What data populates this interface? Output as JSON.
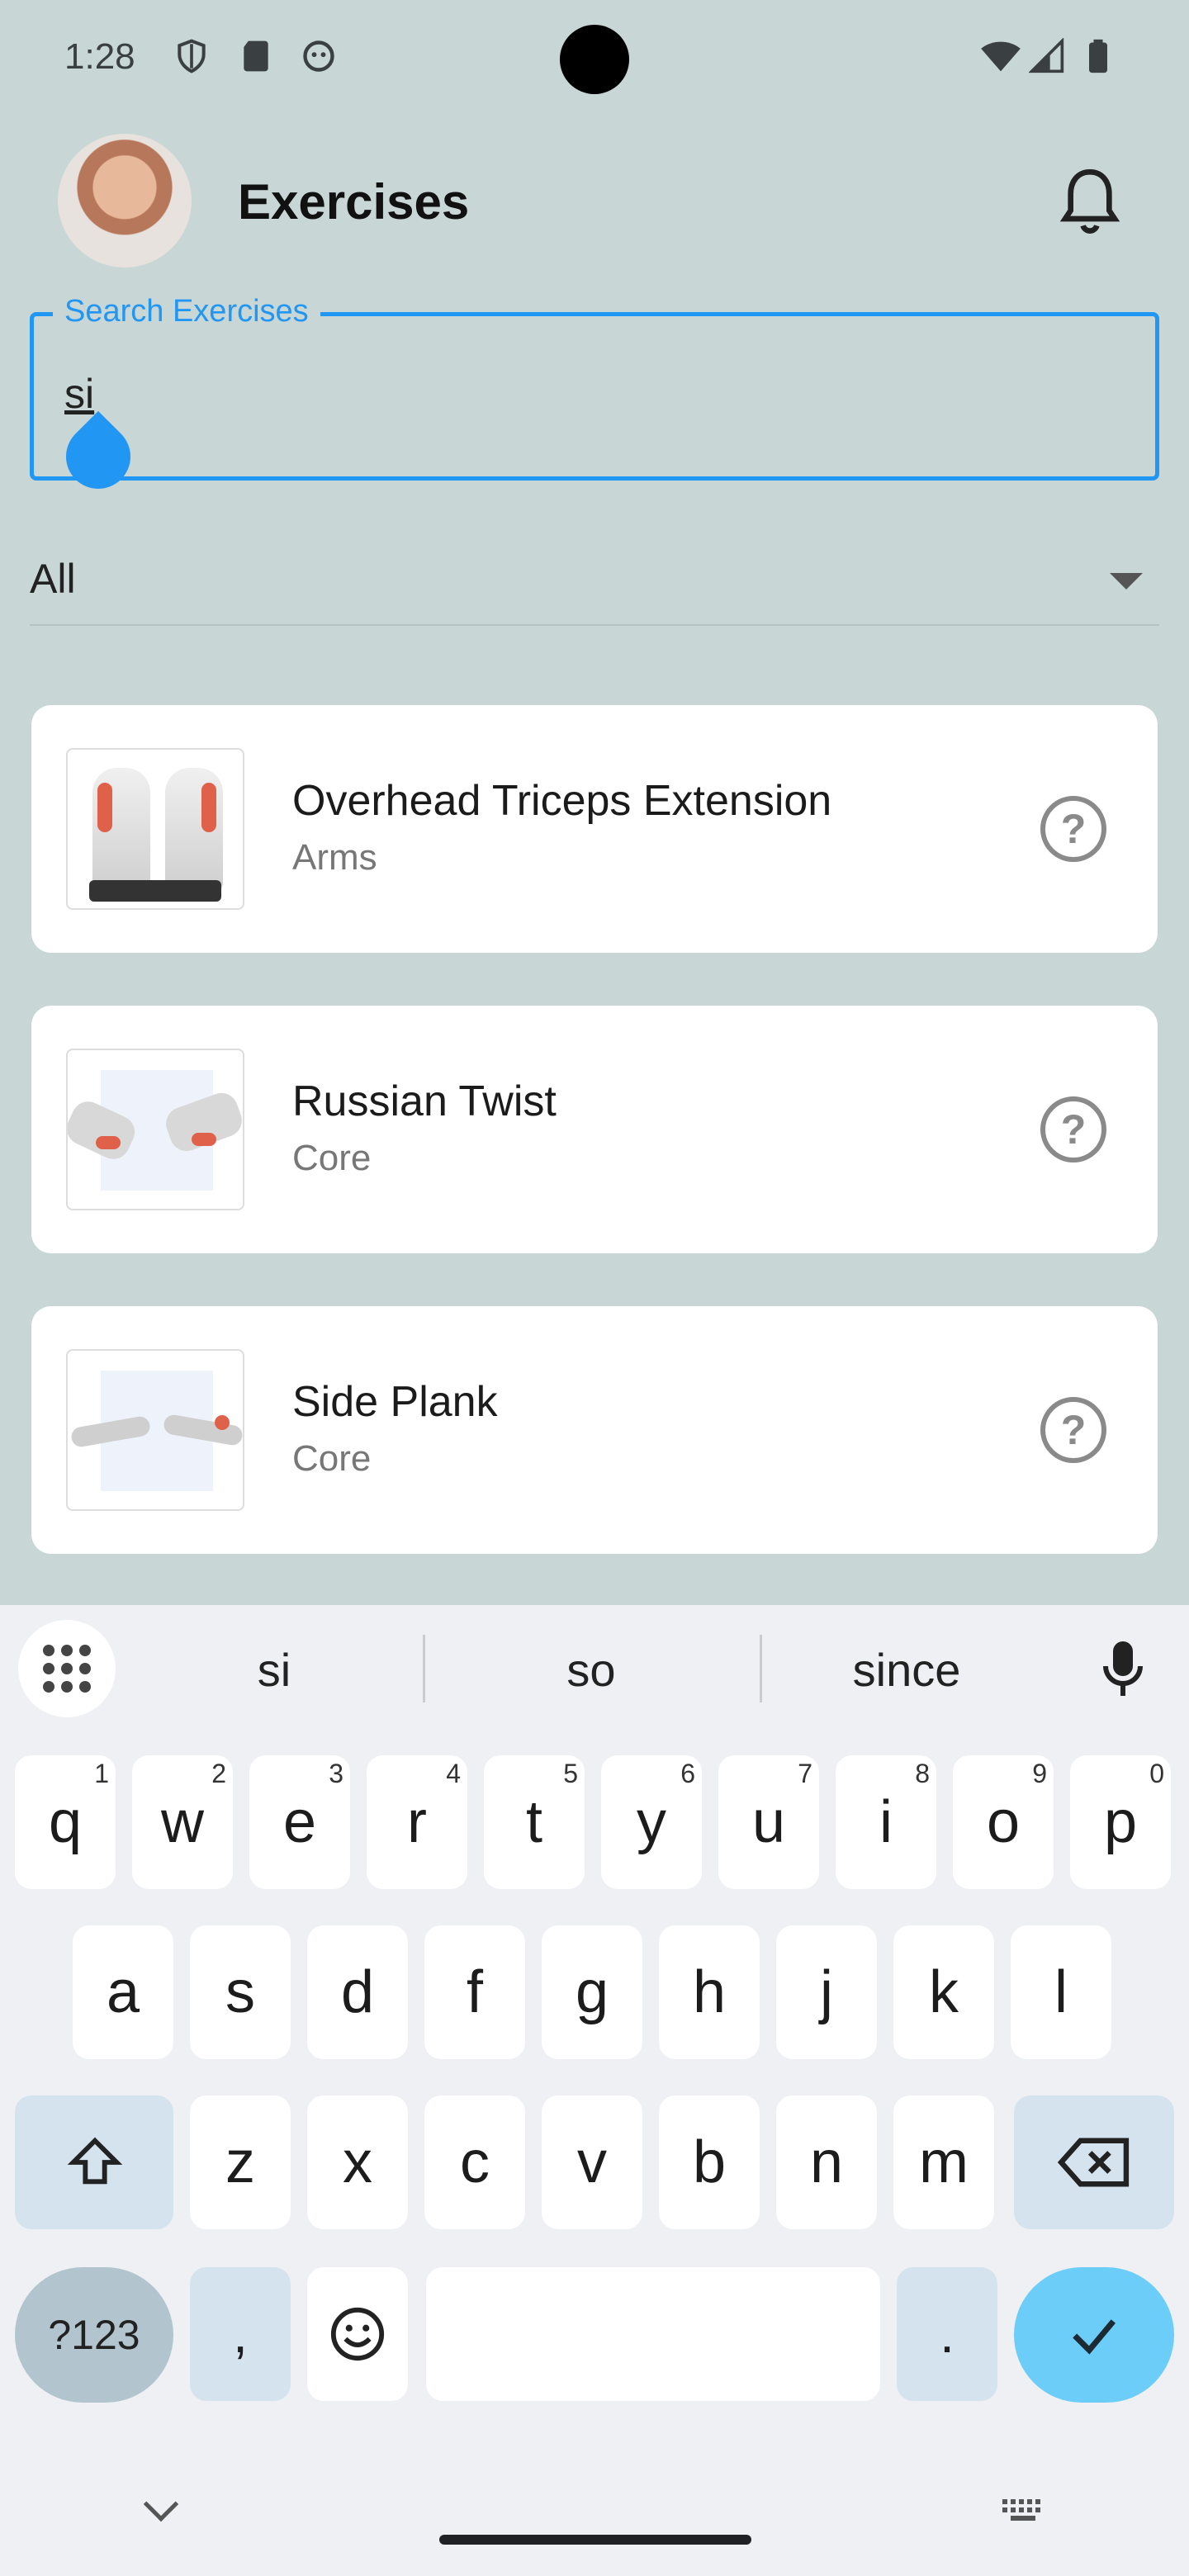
{
  "status_bar": {
    "time": "1:28"
  },
  "header": {
    "title": "Exercises"
  },
  "search": {
    "label": "Search Exercises",
    "value": "si"
  },
  "filter": {
    "selected": "All"
  },
  "exercises": [
    {
      "name": "Overhead Triceps Extension",
      "category": "Arms"
    },
    {
      "name": "Russian Twist",
      "category": "Core"
    },
    {
      "name": "Side Plank",
      "category": "Core"
    }
  ],
  "keyboard": {
    "suggestions": [
      "si",
      "so",
      "since"
    ],
    "row1": [
      "q",
      "w",
      "e",
      "r",
      "t",
      "y",
      "u",
      "i",
      "o",
      "p"
    ],
    "row1_nums": [
      "1",
      "2",
      "3",
      "4",
      "5",
      "6",
      "7",
      "8",
      "9",
      "0"
    ],
    "row2": [
      "a",
      "s",
      "d",
      "f",
      "g",
      "h",
      "j",
      "k",
      "l"
    ],
    "row3": [
      "z",
      "x",
      "c",
      "v",
      "b",
      "n",
      "m"
    ],
    "sym_label": "?123",
    "comma": ",",
    "period": "."
  },
  "colors": {
    "accent": "#2196f3",
    "background": "#c8d6d5",
    "enter": "#6ccdf9"
  }
}
